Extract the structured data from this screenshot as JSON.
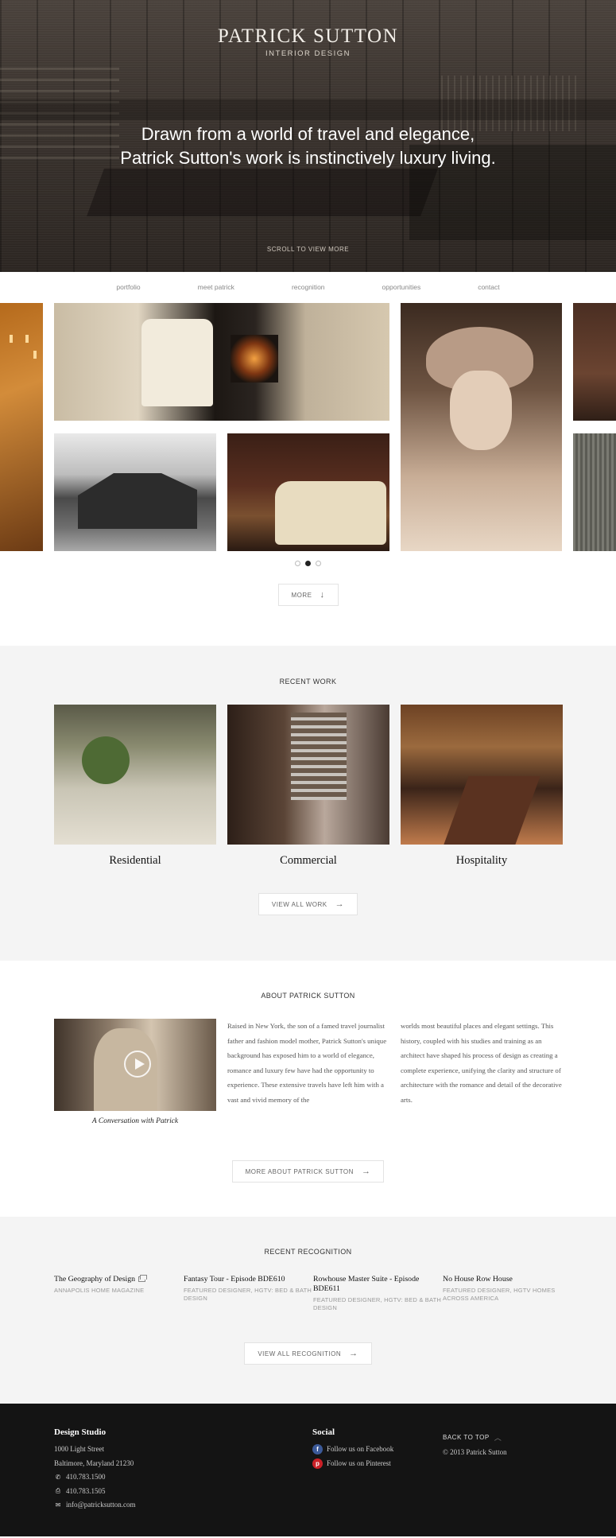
{
  "brand": {
    "name": "PATRICK SUTTON",
    "tagline": "INTERIOR DESIGN"
  },
  "hero": {
    "quote_line1": "Drawn from a world of travel and elegance,",
    "quote_line2": "Patrick Sutton's work is instinctively luxury living.",
    "scroll_label": "SCROLL TO VIEW MORE"
  },
  "nav": {
    "items": [
      "portfolio",
      "meet patrick",
      "recognition",
      "opportunities",
      "contact"
    ]
  },
  "gallery": {
    "slides": 3,
    "active_slide": 2,
    "more_label": "MORE"
  },
  "recent_work": {
    "title": "RECENT WORK",
    "items": [
      "Residential",
      "Commercial",
      "Hospitality"
    ],
    "button_label": "VIEW ALL WORK"
  },
  "about": {
    "title": "ABOUT PATRICK SUTTON",
    "video_caption": "A Conversation with Patrick",
    "text_col1": "Raised in New York, the son of a famed travel journalist father and fashion model mother, Patrick Sutton's unique background has exposed him to a world of elegance, romance and luxury few have had the opportunity to experience. These extensive travels have left him with a vast and vivid memory of the",
    "text_col2": "worlds most beautiful places and elegant settings. This history, coupled with his studies and training as an architect have shaped his process of design as creating a complete experience, unifying the clarity and structure of architecture with the romance and detail of the decorative arts.",
    "button_label": "MORE ABOUT PATRICK SUTTON"
  },
  "recognition": {
    "title": "RECENT RECOGNITION",
    "items": [
      {
        "title": "The Geography of Design",
        "meta": "ANNAPOLIS HOME MAGAZINE"
      },
      {
        "title": "Fantasy Tour - Episode BDE610",
        "meta": "FEATURED DESIGNER, HGTV: BED & BATH DESIGN"
      },
      {
        "title": "Rowhouse Master Suite - Episode BDE611",
        "meta": "FEATURED DESIGNER, HGTV: BED & BATH DESIGN"
      },
      {
        "title": "No House Row House",
        "meta": "FEATURED DESIGNER, HGTV HOMES ACROSS AMERICA"
      }
    ],
    "button_label": "VIEW ALL RECOGNITION"
  },
  "footer": {
    "studio_title": "Design Studio",
    "address1": "1000 Light Street",
    "address2": "Baltimore, Maryland 21230",
    "phone": "410.783.1500",
    "fax": "410.783.1505",
    "email": "info@patricksutton.com",
    "social_title": "Social",
    "facebook": "Follow us on Facebook",
    "pinterest": "Follow us on Pinterest",
    "back_to_top": "BACK TO TOP",
    "copyright": "© 2013 Patrick Sutton"
  },
  "icons": {
    "facebook": "facebook-icon",
    "pinterest": "pinterest-icon",
    "phone": "phone-icon",
    "fax": "fax-icon",
    "email": "email-icon"
  },
  "colors": {
    "footer_bg": "#141414",
    "section_grey": "#f4f4f4",
    "facebook": "#3b5998",
    "pinterest": "#cb2027"
  }
}
